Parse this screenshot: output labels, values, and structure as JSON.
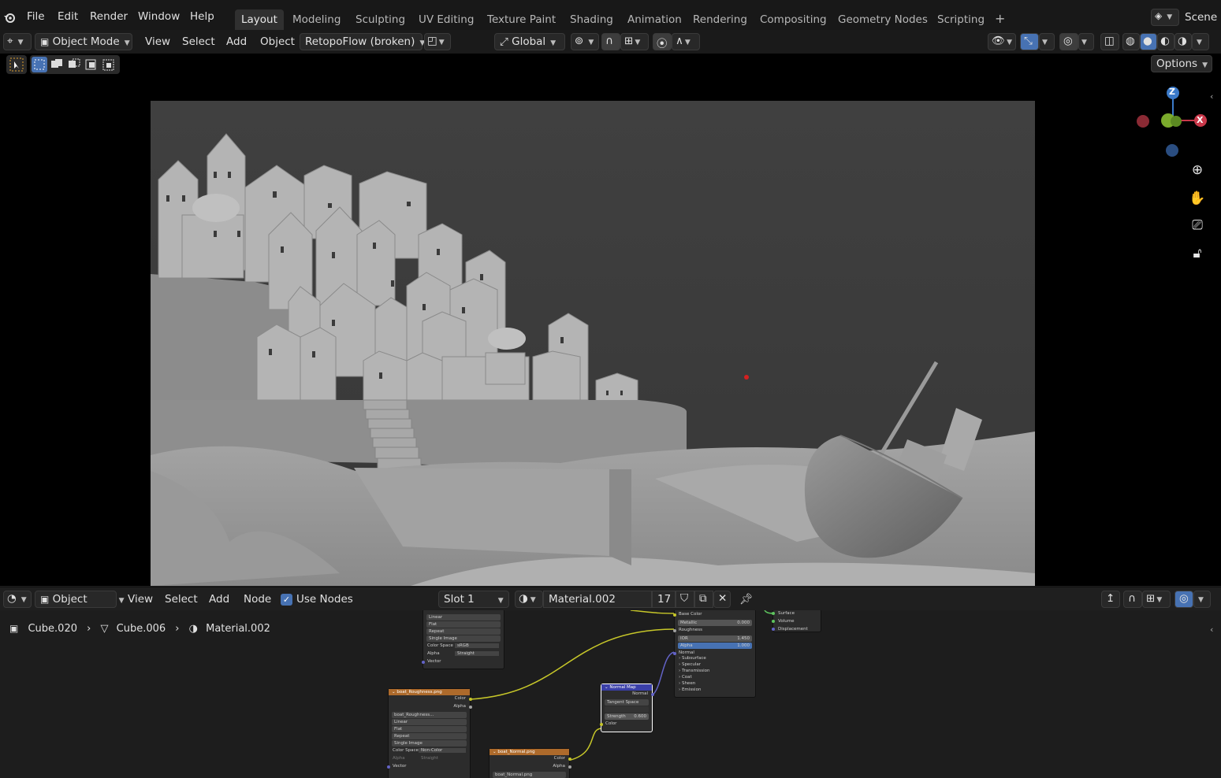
{
  "topbar": {
    "menu": [
      "File",
      "Edit",
      "Render",
      "Window",
      "Help"
    ],
    "workspaces": [
      "Layout",
      "Modeling",
      "Sculpting",
      "UV Editing",
      "Texture Paint",
      "Shading",
      "Animation",
      "Rendering",
      "Compositing",
      "Geometry Nodes",
      "Scripting"
    ],
    "active_workspace": "Layout",
    "add_tab": "+",
    "scene_label": "Scene"
  },
  "viewport_header": {
    "mode": "Object Mode",
    "menu": [
      "View",
      "Select",
      "Add",
      "Object"
    ],
    "addon": "RetopoFlow (broken)",
    "orientation": "Global",
    "options": "Options"
  },
  "gizmo": {
    "z": "Z",
    "x": "X"
  },
  "node_header": {
    "editor_type": "Object",
    "menu": [
      "View",
      "Select",
      "Add",
      "Node"
    ],
    "use_nodes_label": "Use Nodes",
    "use_nodes_checked": true,
    "slot": "Slot 1",
    "material": "Material.002",
    "users": "17"
  },
  "breadcrumb": {
    "object": "Cube.020",
    "mesh": "Cube.006",
    "material": "Material.002"
  },
  "nodes": {
    "image_top": {
      "rows": [
        "Linear",
        "Flat",
        "Repeat",
        "Single Image"
      ],
      "color_space_label": "Color Space",
      "color_space": "sRGB",
      "alpha_label": "Alpha",
      "alpha": "Straight",
      "vector": "Vector"
    },
    "roughness": {
      "title": "boat_Roughness.png",
      "out_color": "Color",
      "out_alpha": "Alpha",
      "file": "boat_Roughness...",
      "rows": [
        "Linear",
        "Flat",
        "Repeat",
        "Single Image"
      ],
      "color_space_label": "Color Space",
      "color_space": "Non-Color",
      "alpha_label": "Alpha",
      "alpha": "Straight",
      "vector": "Vector"
    },
    "normal_img": {
      "title": "boat_Normal.png",
      "out_color": "Color",
      "out_alpha": "Alpha",
      "file": "boat_Normal.png"
    },
    "normal_map": {
      "title": "Normal Map",
      "out_normal": "Normal",
      "space": "Tangent Space",
      "strength_label": "Strength",
      "strength": "0.600",
      "in_color": "Color"
    },
    "bsdf": {
      "base_color": "Base Color",
      "metallic_label": "Metallic",
      "metallic": "0.000",
      "roughness": "Roughness",
      "ior_label": "IOR",
      "ior": "1.450",
      "alpha_label": "Alpha",
      "alpha": "1.000",
      "normal": "Normal",
      "panels": [
        "Subsurface",
        "Specular",
        "Transmission",
        "Coat",
        "Sheen",
        "Emission"
      ]
    },
    "output": {
      "inputs": [
        "Surface",
        "Volume",
        "Displacement"
      ]
    }
  },
  "colors": {
    "header_bg": "#181818",
    "accent": "#4772b3",
    "image_node": "#ad6a2b",
    "vector_node": "#3a3fa8",
    "socket_yellow": "#c7c729",
    "socket_purple": "#6363c7",
    "socket_grey": "#a1a1a1"
  }
}
